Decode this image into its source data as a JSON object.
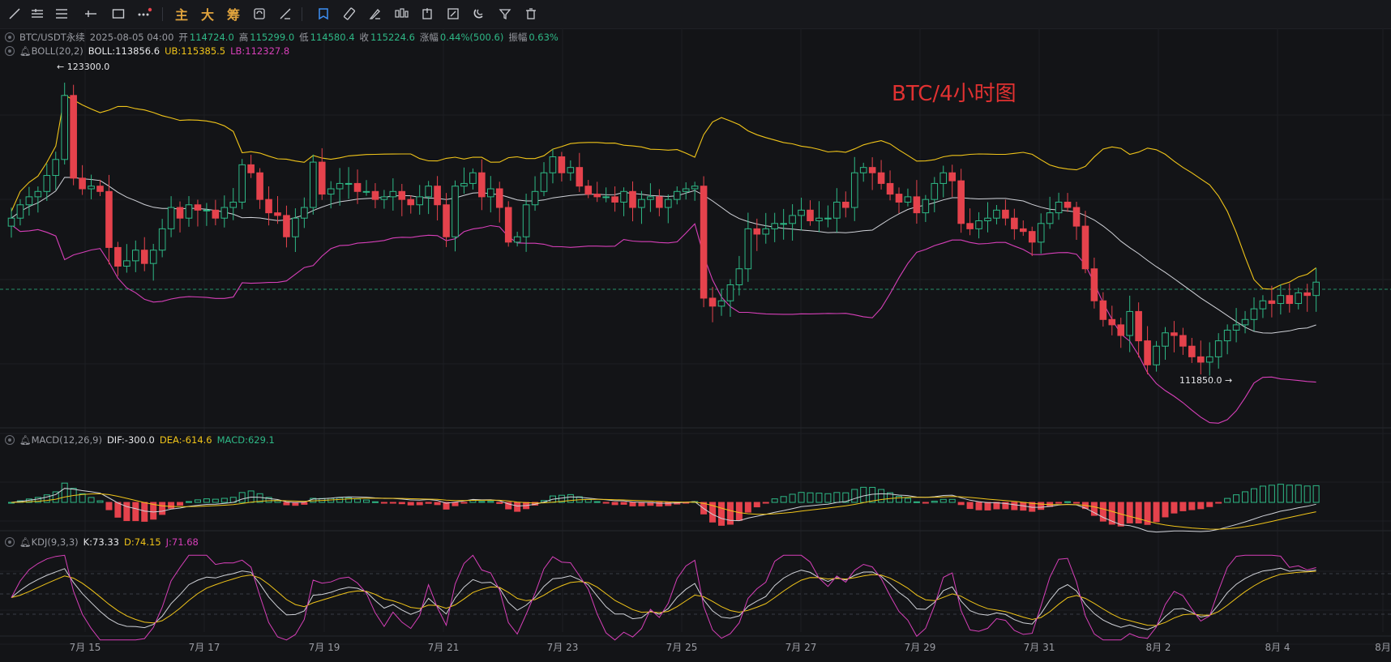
{
  "toolbar": {
    "tools": [
      "trend-line-icon",
      "horizontal-lines-icon",
      "parallel-channel-icon",
      "ray-icon",
      "rectangle-icon",
      "more-icon"
    ],
    "text_buttons": [
      "主",
      "大",
      "筹"
    ],
    "right_tools": [
      "snapshot-icon",
      "measure-icon",
      "brush-icon",
      "layout-icon",
      "export-icon",
      "edit-icon",
      "magnet-icon",
      "filter-icon",
      "trash-icon"
    ]
  },
  "legend_main": {
    "symbol": "BTC/USDT永续",
    "datetime": "2025-08-05 04:00",
    "open_label": "开",
    "open": "114724.0",
    "high_label": "高",
    "high": "115299.0",
    "low_label": "低",
    "low": "114580.4",
    "close_label": "收",
    "close": "115224.6",
    "change_label": "涨幅",
    "change": "0.44%(500.6)",
    "amp_label": "振幅",
    "amp": "0.63%"
  },
  "legend_boll": {
    "name": "BOLL(20,2)",
    "boll": "BOLL:113856.6",
    "ub": "UB:115385.5",
    "lb": "LB:112327.8"
  },
  "legend_macd": {
    "name": "MACD(12,26,9)",
    "dif": "DIF:-300.0",
    "dea": "DEA:-614.6",
    "macd": "MACD:629.1"
  },
  "legend_kdj": {
    "name": "KDJ(9,3,3)",
    "k": "K:73.33",
    "d": "D:74.15",
    "j": "J:71.68"
  },
  "title": "BTC/4小时图",
  "high_marker": "← 123300.0",
  "low_marker": "111850.0 →",
  "x_axis": [
    "7月 15",
    "7月 17",
    "7月 19",
    "7月 21",
    "7月 23",
    "7月 25",
    "7月 27",
    "7月 29",
    "7月 31",
    "8月 2",
    "8月 4",
    "8月"
  ],
  "colors": {
    "up": "#2eb886",
    "down": "#e5424c",
    "ub": "#f0c419",
    "mid": "#d0d2d8",
    "lb": "#d63fb8",
    "bg": "#131417"
  },
  "chart_data": {
    "type": "candlestick",
    "interval": "4h",
    "price_range": [
      111850,
      123300
    ],
    "candles_close": [
      117600,
      118100,
      118400,
      118600,
      119200,
      119800,
      122200,
      119100,
      118700,
      118800,
      118600,
      116500,
      115800,
      116000,
      116400,
      115900,
      116400,
      117200,
      118000,
      117600,
      118100,
      117900,
      117900,
      117600,
      118000,
      118200,
      119600,
      119300,
      118300,
      117800,
      117700,
      116900,
      117600,
      118000,
      119700,
      118500,
      118700,
      118900,
      118900,
      118600,
      118600,
      118300,
      118400,
      118600,
      118300,
      118100,
      118400,
      118800,
      118100,
      116900,
      118800,
      118900,
      119300,
      118400,
      118700,
      118000,
      116700,
      116900,
      118100,
      118600,
      119300,
      119900,
      119300,
      119500,
      118800,
      118500,
      118400,
      118400,
      118200,
      118600,
      118000,
      118300,
      118400,
      118000,
      118300,
      118600,
      118700,
      118800,
      114600,
      114300,
      114500,
      115100,
      115700,
      117200,
      117000,
      117200,
      117400,
      117400,
      117700,
      117900,
      117500,
      117600,
      117600,
      118200,
      118000,
      119300,
      119500,
      119300,
      118900,
      118500,
      118200,
      118400,
      117800,
      118300,
      118900,
      119300,
      119000,
      117400,
      117200,
      117500,
      117600,
      117900,
      117600,
      117200,
      117100,
      116700,
      117400,
      117800,
      118200,
      118000,
      117300,
      115700,
      114500,
      113800,
      113600,
      113200,
      114100,
      113000,
      112100,
      112800,
      113300,
      113200,
      112800,
      112400,
      112200,
      112400,
      113000,
      113400,
      113600,
      113800,
      114200,
      114500,
      114400,
      114700,
      114400,
      114800,
      114700,
      115200
    ],
    "boll": {
      "mid": 113856.6,
      "ub": 115385.5,
      "lb": 112327.8
    },
    "macd": {
      "dif": -300.0,
      "dea": -614.6,
      "macd": 629.1
    },
    "kdj": {
      "k": 73.33,
      "d": 74.15,
      "j": 71.68
    }
  }
}
